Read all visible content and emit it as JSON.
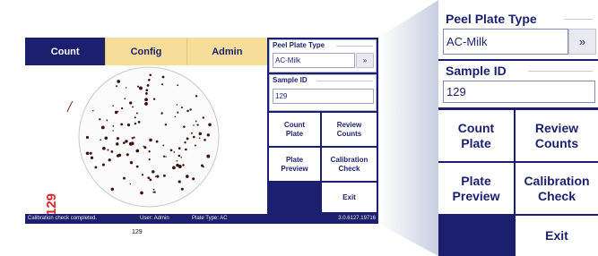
{
  "tabs": [
    {
      "label": "Count",
      "active": true
    },
    {
      "label": "Config",
      "active": false
    },
    {
      "label": "Admin",
      "active": false
    }
  ],
  "plate": {
    "number_vertical": "129",
    "number_label": "129"
  },
  "side_panel": {
    "plate_type": {
      "title": "Peel Plate Type",
      "value": "AC-Milk",
      "next_label": "»"
    },
    "sample_id": {
      "title": "Sample ID",
      "value": "129"
    },
    "buttons": {
      "count_plate": "Count\nPlate",
      "review_counts": "Review\nCounts",
      "plate_preview": "Plate\nPreview",
      "calibration_check": "Calibration\nCheck",
      "exit": "Exit"
    }
  },
  "statusbar": {
    "message": "Calibration check completed.",
    "user": "User: Admin",
    "plate_type": "Plate Type: AC",
    "version": "3.0.6127.19716"
  },
  "colors": {
    "navy": "#1c1f6e",
    "tab_inactive": "#f7dd9a",
    "plate_number": "#d9262b",
    "colony": "#3a1410"
  }
}
